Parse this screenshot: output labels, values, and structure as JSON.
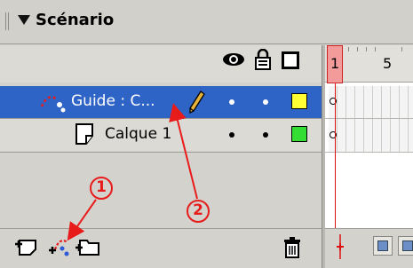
{
  "panel": {
    "title": "Scénario"
  },
  "header": {
    "icons": [
      "eye-icon",
      "lock-icon",
      "outline-icon"
    ]
  },
  "layers": [
    {
      "label": "Guide : C...",
      "type": "guide",
      "color": "#ffff33",
      "selected": true
    },
    {
      "label": "Calque 1",
      "type": "normal",
      "color": "#33dd33",
      "selected": false
    }
  ],
  "timeline": {
    "frame_labels": [
      "1",
      "5"
    ]
  },
  "annotations": {
    "callout_1": "1",
    "callout_2": "2"
  },
  "colors": {
    "selection": "#2f64c7",
    "annotation": "#e81b1b",
    "playhead": "#d11111"
  }
}
